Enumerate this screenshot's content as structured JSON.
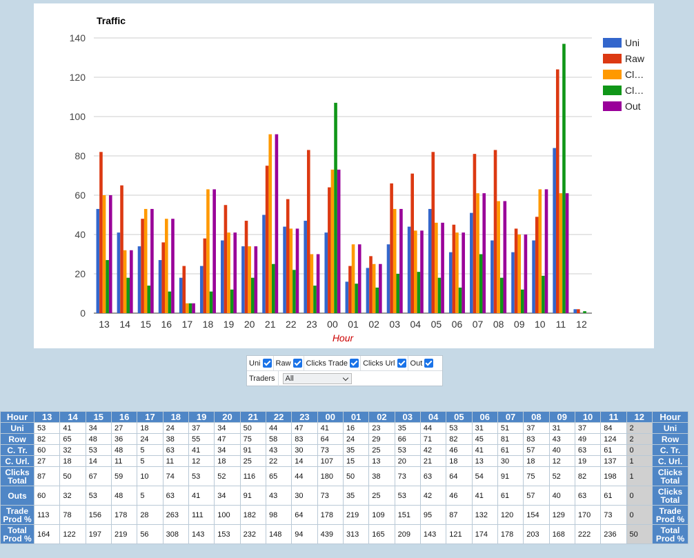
{
  "chart_data": {
    "type": "bar",
    "title": "Traffic",
    "xlabel": "Hour",
    "ylabel": "",
    "ylim": [
      0,
      140
    ],
    "yticks": [
      0,
      20,
      40,
      60,
      80,
      100,
      120,
      140
    ],
    "grid": true,
    "legend_position": "right",
    "categories": [
      "13",
      "14",
      "15",
      "16",
      "17",
      "18",
      "19",
      "20",
      "21",
      "22",
      "23",
      "00",
      "01",
      "02",
      "03",
      "04",
      "05",
      "06",
      "07",
      "08",
      "09",
      "10",
      "11",
      "12"
    ],
    "series": [
      {
        "name": "Uni",
        "legend": "Uni",
        "color": "#3366cc",
        "values": [
          53,
          41,
          34,
          27,
          18,
          24,
          37,
          34,
          50,
          44,
          47,
          41,
          16,
          23,
          35,
          44,
          53,
          31,
          51,
          37,
          31,
          37,
          84,
          2
        ]
      },
      {
        "name": "Raw",
        "legend": "Raw",
        "color": "#dc3912",
        "values": [
          82,
          65,
          48,
          36,
          24,
          38,
          55,
          47,
          75,
          58,
          83,
          64,
          24,
          29,
          66,
          71,
          82,
          45,
          81,
          83,
          43,
          49,
          124,
          2
        ]
      },
      {
        "name": "Clicks Trade",
        "legend": "Cl…",
        "color": "#ff9900",
        "values": [
          60,
          32,
          53,
          48,
          5,
          63,
          41,
          34,
          91,
          43,
          30,
          73,
          35,
          25,
          53,
          42,
          46,
          41,
          61,
          57,
          40,
          63,
          61,
          0
        ]
      },
      {
        "name": "Clicks Url",
        "legend": "Cl…",
        "color": "#109618",
        "values": [
          27,
          18,
          14,
          11,
          5,
          11,
          12,
          18,
          25,
          22,
          14,
          107,
          15,
          13,
          20,
          21,
          18,
          13,
          30,
          18,
          12,
          19,
          137,
          1
        ]
      },
      {
        "name": "Out",
        "legend": "Out",
        "color": "#990099",
        "values": [
          60,
          32,
          53,
          48,
          5,
          63,
          41,
          34,
          91,
          43,
          30,
          73,
          35,
          25,
          53,
          42,
          46,
          41,
          61,
          57,
          40,
          63,
          61,
          0
        ]
      }
    ]
  },
  "controls": {
    "checkboxes": [
      {
        "label": "Uni",
        "checked": true
      },
      {
        "label": "Raw",
        "checked": true
      },
      {
        "label": "Clicks Trade",
        "checked": true
      },
      {
        "label": "Clicks Url",
        "checked": true
      },
      {
        "label": "Out",
        "checked": true
      }
    ],
    "traders_label": "Traders",
    "traders_value": "All"
  },
  "table": {
    "header_label": "Hour",
    "hours": [
      "13",
      "14",
      "15",
      "16",
      "17",
      "18",
      "19",
      "20",
      "21",
      "22",
      "23",
      "00",
      "01",
      "02",
      "03",
      "04",
      "05",
      "06",
      "07",
      "08",
      "09",
      "10",
      "11",
      "12"
    ],
    "rows": [
      {
        "label": "Uni",
        "right_label": "Uni",
        "tall": false,
        "values": [
          "53",
          "41",
          "34",
          "27",
          "18",
          "24",
          "37",
          "34",
          "50",
          "44",
          "47",
          "41",
          "16",
          "23",
          "35",
          "44",
          "53",
          "31",
          "51",
          "37",
          "31",
          "37",
          "84",
          "2"
        ]
      },
      {
        "label": "Row",
        "right_label": "Row",
        "tall": false,
        "values": [
          "82",
          "65",
          "48",
          "36",
          "24",
          "38",
          "55",
          "47",
          "75",
          "58",
          "83",
          "64",
          "24",
          "29",
          "66",
          "71",
          "82",
          "45",
          "81",
          "83",
          "43",
          "49",
          "124",
          "2"
        ]
      },
      {
        "label": "C. Tr.",
        "right_label": "C. Tr.",
        "tall": false,
        "values": [
          "60",
          "32",
          "53",
          "48",
          "5",
          "63",
          "41",
          "34",
          "91",
          "43",
          "30",
          "73",
          "35",
          "25",
          "53",
          "42",
          "46",
          "41",
          "61",
          "57",
          "40",
          "63",
          "61",
          "0"
        ]
      },
      {
        "label": "C. Url.",
        "right_label": "C. Url.",
        "tall": false,
        "values": [
          "27",
          "18",
          "14",
          "11",
          "5",
          "11",
          "12",
          "18",
          "25",
          "22",
          "14",
          "107",
          "15",
          "13",
          "20",
          "21",
          "18",
          "13",
          "30",
          "18",
          "12",
          "19",
          "137",
          "1"
        ]
      },
      {
        "label": "Clicks Total",
        "right_label": "Clicks Total",
        "tall": true,
        "values": [
          "87",
          "50",
          "67",
          "59",
          "10",
          "74",
          "53",
          "52",
          "116",
          "65",
          "44",
          "180",
          "50",
          "38",
          "73",
          "63",
          "64",
          "54",
          "91",
          "75",
          "52",
          "82",
          "198",
          "1"
        ]
      },
      {
        "label": "Outs",
        "right_label": "Clicks Total",
        "tall": true,
        "values": [
          "60",
          "32",
          "53",
          "48",
          "5",
          "63",
          "41",
          "34",
          "91",
          "43",
          "30",
          "73",
          "35",
          "25",
          "53",
          "42",
          "46",
          "41",
          "61",
          "57",
          "40",
          "63",
          "61",
          "0"
        ]
      },
      {
        "label": "Trade Prod %",
        "right_label": "Trade Prod %",
        "tall": true,
        "values": [
          "113",
          "78",
          "156",
          "178",
          "28",
          "263",
          "111",
          "100",
          "182",
          "98",
          "64",
          "178",
          "219",
          "109",
          "151",
          "95",
          "87",
          "132",
          "120",
          "154",
          "129",
          "170",
          "73",
          "0"
        ]
      },
      {
        "label": "Total Prod %",
        "right_label": "Total Prod %",
        "tall": true,
        "values": [
          "164",
          "122",
          "197",
          "219",
          "56",
          "308",
          "143",
          "153",
          "232",
          "148",
          "94",
          "439",
          "313",
          "165",
          "209",
          "143",
          "121",
          "174",
          "178",
          "203",
          "168",
          "222",
          "236",
          "50"
        ]
      }
    ]
  }
}
